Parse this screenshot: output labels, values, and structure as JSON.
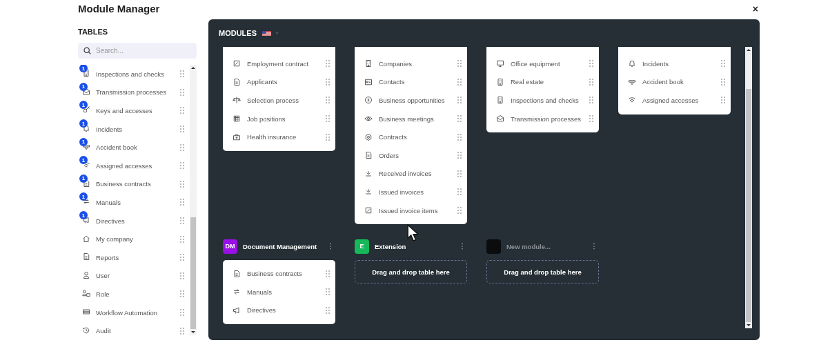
{
  "window": {
    "title": "Module Manager",
    "close": "×"
  },
  "tables": {
    "heading": "TABLES",
    "search": {
      "placeholder": "Search..."
    },
    "items": [
      {
        "label": "Inspections and checks",
        "badge": "1"
      },
      {
        "label": "Transmission processes",
        "badge": "1"
      },
      {
        "label": "Keys and accesses",
        "badge": "1"
      },
      {
        "label": "Incidents",
        "badge": "1"
      },
      {
        "label": "Accident book",
        "badge": "1"
      },
      {
        "label": "Assigned accesses",
        "badge": "1"
      },
      {
        "label": "Business contracts",
        "badge": "1"
      },
      {
        "label": "Manuals",
        "badge": "1"
      },
      {
        "label": "Directives",
        "badge": "1"
      },
      {
        "label": "My company"
      },
      {
        "label": "Reports"
      },
      {
        "label": "User"
      },
      {
        "label": "Role"
      },
      {
        "label": "Workflow Automation"
      },
      {
        "label": "Audit"
      }
    ]
  },
  "modules": {
    "heading": "MODULES",
    "items": [
      {
        "kind": "tables",
        "tables": [
          "Employment contract",
          "Applicants",
          "Selection process",
          "Job positions",
          "Health insurance"
        ]
      },
      {
        "kind": "tables",
        "tables": [
          "Companies",
          "Contacts",
          "Business opportunities",
          "Business meetings",
          "Contracts",
          "Orders",
          "Received invoices",
          "Issued invoices",
          "Issued invoice items"
        ]
      },
      {
        "kind": "tables",
        "tables": [
          "Office equipment",
          "Real estate",
          "Inspections and checks",
          "Transmission processes"
        ]
      },
      {
        "kind": "tables",
        "tables": [
          "Incidents",
          "Accident book",
          "Assigned accesses"
        ]
      },
      {
        "kind": "tables",
        "avatar": "DM",
        "color": "#9810e6",
        "name": "Document Management",
        "draft": false,
        "tables": [
          "Business contracts",
          "Manuals",
          "Directives"
        ]
      },
      {
        "kind": "dropzone",
        "avatar": "E",
        "color": "#16b85a",
        "name": "Extension",
        "draft": false,
        "hint": "Drag and drop table here"
      },
      {
        "kind": "dropzone",
        "color": "#0b0c0e",
        "name": "New module...",
        "draft": true,
        "hint": "Drag and drop table here"
      }
    ]
  }
}
